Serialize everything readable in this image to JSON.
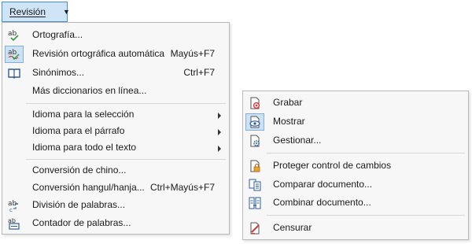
{
  "menu_button": {
    "label": "Revisión"
  },
  "main_menu": {
    "items": [
      {
        "label": "Ortografía...",
        "shortcut": "",
        "icon": "spellcheck-icon"
      },
      {
        "label": "Revisión ortográfica automática",
        "shortcut": "Mayús+F7",
        "icon": "autospellcheck-icon",
        "checked": true
      },
      {
        "label": "Sinónimos...",
        "shortcut": "Ctrl+F7",
        "icon": "thesaurus-icon"
      },
      {
        "label": "Más diccionarios en línea...",
        "shortcut": ""
      },
      {
        "label": "Idioma para la selección",
        "submenu": true
      },
      {
        "label": "Idioma para el párrafo",
        "submenu": true
      },
      {
        "label": "Idioma para todo el texto",
        "submenu": true
      },
      {
        "label": "Conversión de chino...",
        "shortcut": ""
      },
      {
        "label": "Conversión hangul/hanja...",
        "shortcut": "Ctrl+Mayús+F7"
      },
      {
        "label": "División de palabras...",
        "shortcut": "",
        "icon": "hyphenation-icon"
      },
      {
        "label": "Contador de palabras...",
        "shortcut": "",
        "icon": "word-count-icon"
      }
    ]
  },
  "sub_menu": {
    "items": [
      {
        "label": "Grabar",
        "icon": "record-changes-icon"
      },
      {
        "label": "Mostrar",
        "icon": "show-changes-icon"
      },
      {
        "label": "Gestionar...",
        "icon": "manage-changes-icon"
      },
      {
        "label": "Proteger control de cambios",
        "icon": "protect-changes-icon"
      },
      {
        "label": "Comparar documento...",
        "icon": "compare-document-icon"
      },
      {
        "label": "Combinar documento...",
        "icon": "merge-document-icon"
      },
      {
        "label": "Censurar",
        "icon": "redact-icon"
      }
    ]
  },
  "colors": {
    "accent": "#4a90c8",
    "menu_bg": "#f7f7f7",
    "check_bg": "#cde1f3"
  }
}
